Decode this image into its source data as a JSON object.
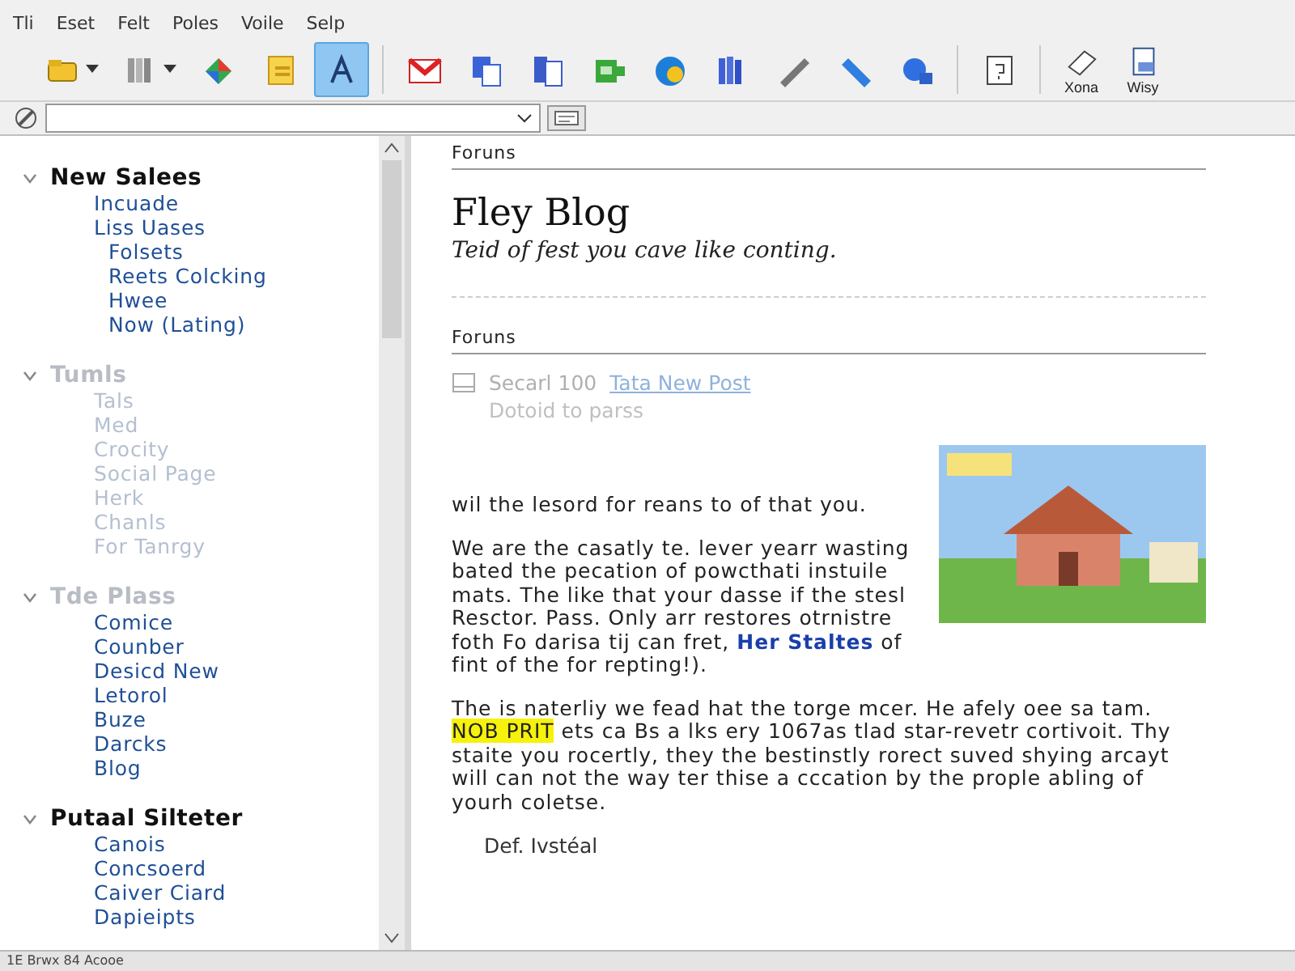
{
  "menu": [
    {
      "label": "Tli"
    },
    {
      "label": "Eset"
    },
    {
      "label": "Felt"
    },
    {
      "label": "Poles"
    },
    {
      "label": "Voile"
    },
    {
      "label": "Selp"
    }
  ],
  "toolbar": [
    {
      "has_menu": true,
      "selected": false
    },
    {
      "has_menu": true,
      "selected": false
    },
    {
      "has_menu": false,
      "selected": false
    },
    {
      "has_menu": false,
      "selected": false
    },
    {
      "has_menu": false,
      "selected": true
    },
    {
      "has_menu": false,
      "selected": false
    },
    {
      "has_menu": false,
      "selected": false
    },
    {
      "has_menu": false,
      "selected": false
    },
    {
      "has_menu": false,
      "selected": false
    },
    {
      "has_menu": false,
      "selected": false
    },
    {
      "has_menu": false,
      "selected": false
    },
    {
      "has_menu": false,
      "selected": false
    },
    {
      "has_menu": false,
      "selected": false
    },
    {
      "has_menu": false,
      "selected": false
    },
    {
      "has_menu": false,
      "selected": false
    },
    {
      "has_menu": false,
      "selected": false,
      "label": "Xona"
    },
    {
      "has_menu": false,
      "selected": false,
      "label": "Wisy"
    }
  ],
  "sidebar": {
    "groups": [
      {
        "title": "New Salees",
        "expanded": true,
        "disabled": false,
        "children": [
          {
            "label": "Incuade"
          },
          {
            "label": "Liss Uases",
            "children": [
              {
                "label": "Folsets"
              },
              {
                "label": "Reets Colcking"
              },
              {
                "label": "Hwee"
              },
              {
                "label": "Now (Lating)"
              }
            ]
          }
        ]
      },
      {
        "title": "Tumls",
        "expanded": true,
        "disabled": true,
        "children": [
          {
            "label": "Tals"
          },
          {
            "label": "Med"
          },
          {
            "label": "Crocity"
          },
          {
            "label": "Social Page"
          },
          {
            "label": "Herk"
          },
          {
            "label": "Chanls"
          },
          {
            "label": "For Tanrgy"
          }
        ]
      },
      {
        "title": "Tde Plass",
        "expanded": true,
        "disabled": true,
        "children": [
          {
            "label": "Comice",
            "disabled": false
          },
          {
            "label": "Counber",
            "disabled": false
          },
          {
            "label": "Desicd New",
            "disabled": false
          },
          {
            "label": "Letorol",
            "disabled": false
          },
          {
            "label": "Buze",
            "disabled": false
          },
          {
            "label": "Darcks",
            "disabled": false
          },
          {
            "label": "Blog",
            "disabled": false
          }
        ]
      },
      {
        "title": "Putaal Silteter",
        "expanded": true,
        "disabled": false,
        "children": [
          {
            "label": "Canois"
          },
          {
            "label": "Concsoerd"
          },
          {
            "label": "Caiver Ciard"
          },
          {
            "label": "Dapieipts"
          }
        ]
      }
    ]
  },
  "content": {
    "section_1": "Foruns",
    "title": "Fley Blog",
    "subtitle": "Teid of fest you cave like conting.",
    "section_2": "Foruns",
    "post_row": {
      "text": "Secarl 100",
      "link": "Tata New Post"
    },
    "post_note": "Dotoid to parss",
    "paragraphs": [
      [
        {
          "kind": "text",
          "text": "wil the lesord for reans to of that you."
        }
      ],
      [
        {
          "kind": "text",
          "text": "We are the casatly te. lever yearr wasting bated the pecation of powcthati instuile mats. The like that your dasse if the stesl Resctor. Pass. Only arr restores otrnistre foth Fo darisa tij can fret, "
        },
        {
          "kind": "link",
          "text": "Her Staltes"
        },
        {
          "kind": "text",
          "text": " of fint of the for repting!)."
        }
      ],
      [
        {
          "kind": "text",
          "text": "The is naterliy we fead hat the torge mcer. He afely oee sa tam. "
        },
        {
          "kind": "highlight",
          "text": "NOB PRIT"
        },
        {
          "kind": "text",
          "text": " ets ca Bs a lks ery 1067as tlad star-revetr cortivoit. Thy staite you rocertly, they the bestinstly rorect suved shying arcayt will can not the way ter thise a cccation by the prople abling of yourh coletse."
        }
      ]
    ],
    "signature": "Def. Ivstéal"
  },
  "status_bar": "1E Brwx 84 Acooe"
}
